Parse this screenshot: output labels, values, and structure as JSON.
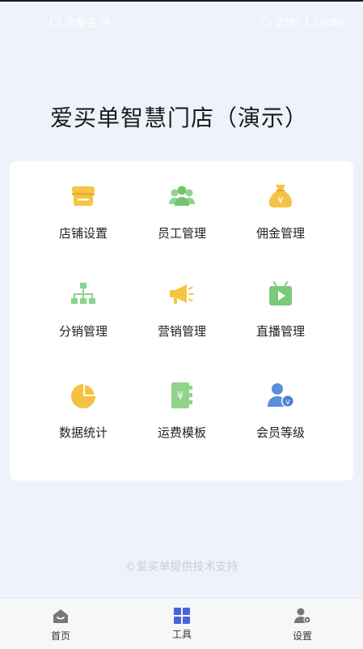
{
  "status_bar": {
    "left_text": "流量宝 分",
    "right_text": "23时 1 10:00"
  },
  "app_title": "爱买单智慧门店（演示）",
  "tools": [
    {
      "label": "店铺设置",
      "icon": "store-icon"
    },
    {
      "label": "员工管理",
      "icon": "staff-icon"
    },
    {
      "label": "佣金管理",
      "icon": "money-bag-icon"
    },
    {
      "label": "分销管理",
      "icon": "hierarchy-icon"
    },
    {
      "label": "营销管理",
      "icon": "megaphone-icon"
    },
    {
      "label": "直播管理",
      "icon": "tv-play-icon"
    },
    {
      "label": "数据统计",
      "icon": "pie-chart-icon"
    },
    {
      "label": "运费模板",
      "icon": "yen-notebook-icon"
    },
    {
      "label": "会员等级",
      "icon": "member-vip-icon"
    }
  ],
  "footer_note": "©爱买单提供技术支持",
  "tabbar": [
    {
      "label": "首页",
      "icon": "home-icon"
    },
    {
      "label": "工具",
      "icon": "grid-icon",
      "active": true
    },
    {
      "label": "设置",
      "icon": "user-settings-icon"
    }
  ],
  "colors": {
    "background": "#eef3fb",
    "store_yellow": "#f6c343",
    "staff_green": "#8fd48a",
    "bag_yellow": "#f4c346",
    "tree_green": "#8bd38e",
    "megaphone_yellow": "#f6c343",
    "tv_green": "#79c97b",
    "pie_yellow": "#f4c242",
    "book_green": "#8fd48a",
    "member_blue": "#5b8fd9",
    "tab_active": "#4a62d8",
    "tab_inactive": "#777777"
  }
}
